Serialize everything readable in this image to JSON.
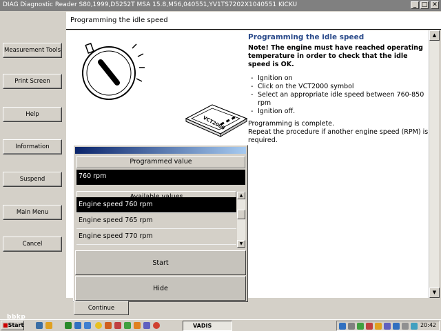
{
  "window": {
    "title": "DIAG Diagnostic Reader S80,1999,D5252T MSA 15.8,M56,040551,YV1TS7202X1040551 KICKU",
    "minimize": "_",
    "restore": "□",
    "close": "✕"
  },
  "header": {
    "title": "Programming the idle speed"
  },
  "sidebar": {
    "buttons": [
      "Measurement Tools",
      "Print Screen",
      "Help",
      "Information",
      "Suspend",
      "Main Menu",
      "Cancel"
    ]
  },
  "info": {
    "heading": "Programming the idle speed",
    "note": "Note! The engine must have reached operating temperature in order to check that the idle speed is OK.",
    "steps": [
      "Ignition on",
      "Click on the VCT2000 symbol",
      "Select an appropriate idle speed between 760-850 rpm",
      "Ignition off."
    ],
    "complete": "Programming is complete.",
    "repeat": "Repeat the procedure if another engine speed (RPM) is required."
  },
  "device": {
    "label": "VCT2000"
  },
  "dialog": {
    "programmed_label": "Programmed value",
    "programmed_value": "760 rpm",
    "available_label": "Available values",
    "options": [
      "Engine speed 760 rpm",
      "Engine speed 765 rpm",
      "Engine speed 770 rpm"
    ],
    "selected_index": 0,
    "start_label": "Start",
    "hide_label": "Hide"
  },
  "footer": {
    "continue_label": "Continue"
  },
  "taskbar": {
    "start_label": "Start",
    "task_label": "VADIS",
    "clock": "20:42"
  },
  "watermark": "bbkp",
  "colors": {
    "heading": "#2a4a8a",
    "dialog_title_start": "#0a246a",
    "dialog_title_end": "#a6caf0"
  }
}
